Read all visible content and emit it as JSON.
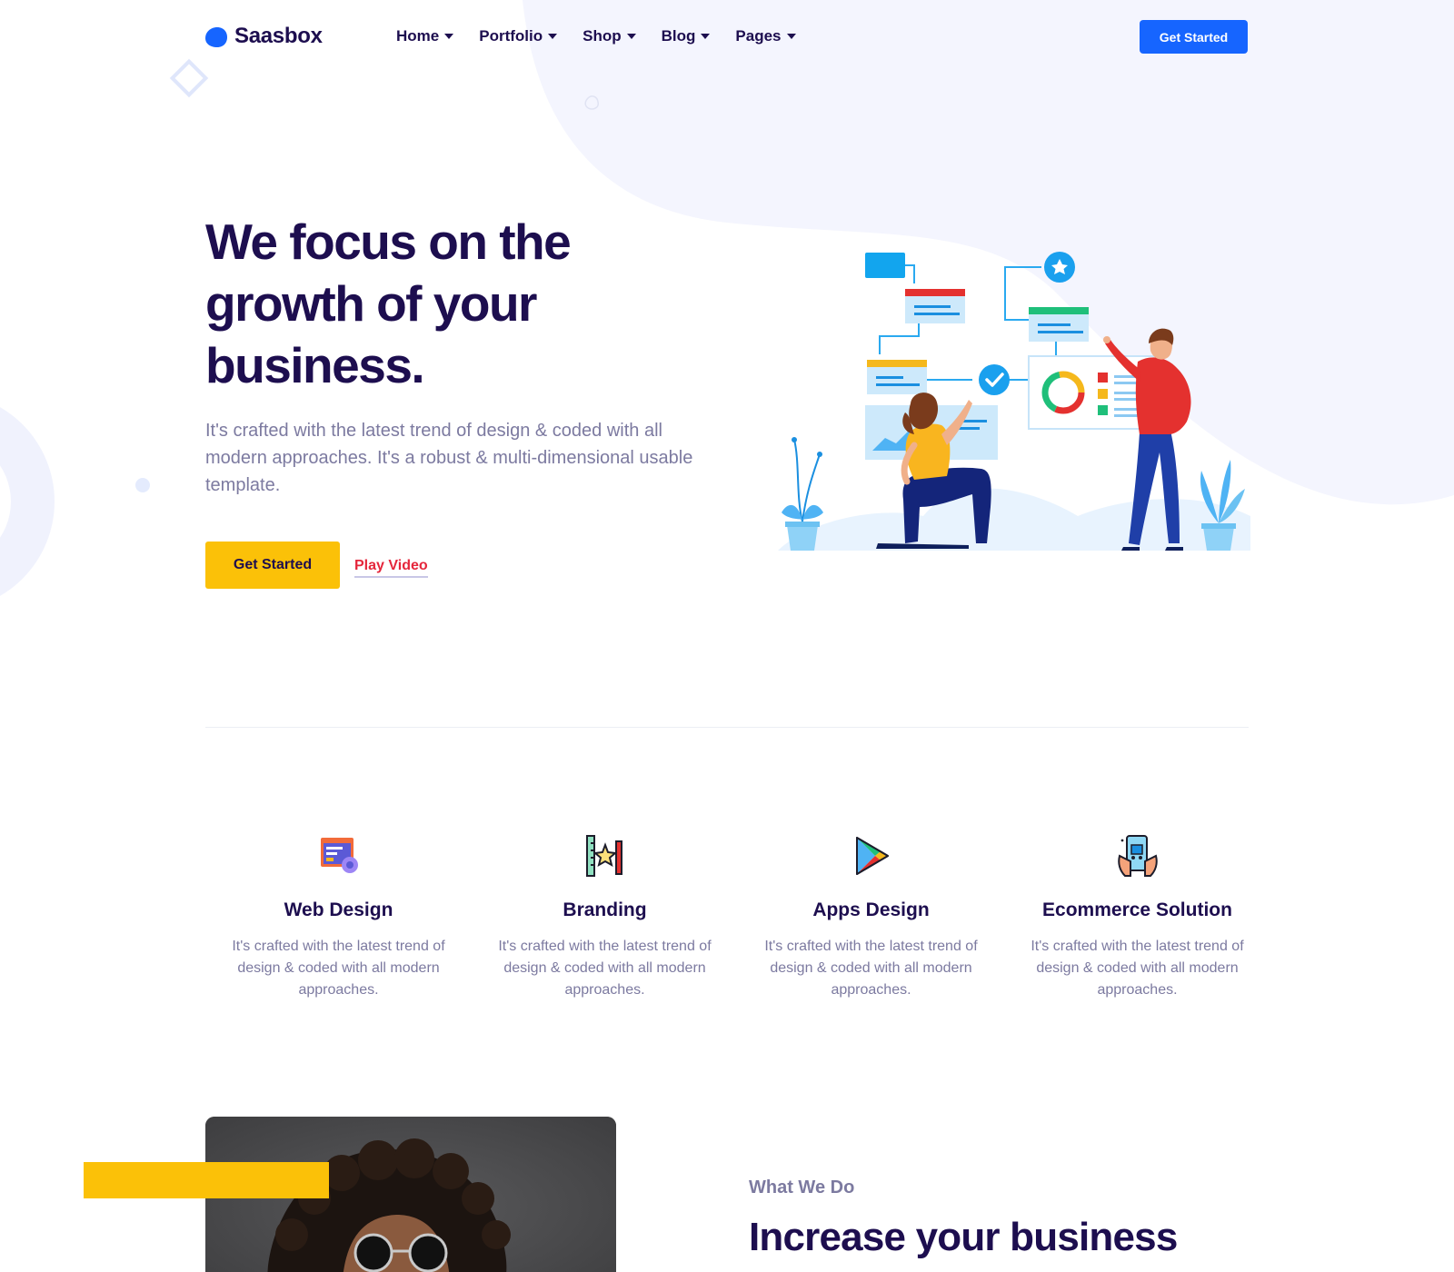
{
  "brand": {
    "name": "Saasbox",
    "logo_icon": "blob-logo-icon"
  },
  "nav": {
    "items": [
      {
        "label": "Home"
      },
      {
        "label": "Portfolio"
      },
      {
        "label": "Shop"
      },
      {
        "label": "Blog"
      },
      {
        "label": "Pages"
      }
    ],
    "cta_label": "Get Started"
  },
  "hero": {
    "title": "We focus on the growth of your business.",
    "text": "It's crafted with the latest trend of design & coded with all modern approaches. It's a robust & multi-dimensional usable template.",
    "primary_button": "Get Started",
    "video_link": "Play Video",
    "illustration": "team-analytics-illustration"
  },
  "services": [
    {
      "icon": "web-design-icon",
      "title": "Web Design",
      "text": "It's crafted with the latest trend of design & coded with all modern approaches."
    },
    {
      "icon": "branding-icon",
      "title": "Branding",
      "text": "It's crafted with the latest trend of design & coded with all modern approaches."
    },
    {
      "icon": "apps-design-icon",
      "title": "Apps Design",
      "text": "It's crafted with the latest trend of design & coded with all modern approaches."
    },
    {
      "icon": "ecommerce-icon",
      "title": "Ecommerce Solution",
      "text": "It's crafted with the latest trend of design & coded with all modern approaches."
    }
  ],
  "about": {
    "label": "What We Do",
    "title": "Increase your business growth with Saasbox",
    "photo": "woman-with-sunglasses-photo"
  },
  "colors": {
    "primary": "#1665ff",
    "accent": "#fbc108",
    "heading": "#1d0e4f",
    "muted": "#7c7aa0",
    "link": "#e5263b",
    "blob": "#f4f5fe"
  }
}
